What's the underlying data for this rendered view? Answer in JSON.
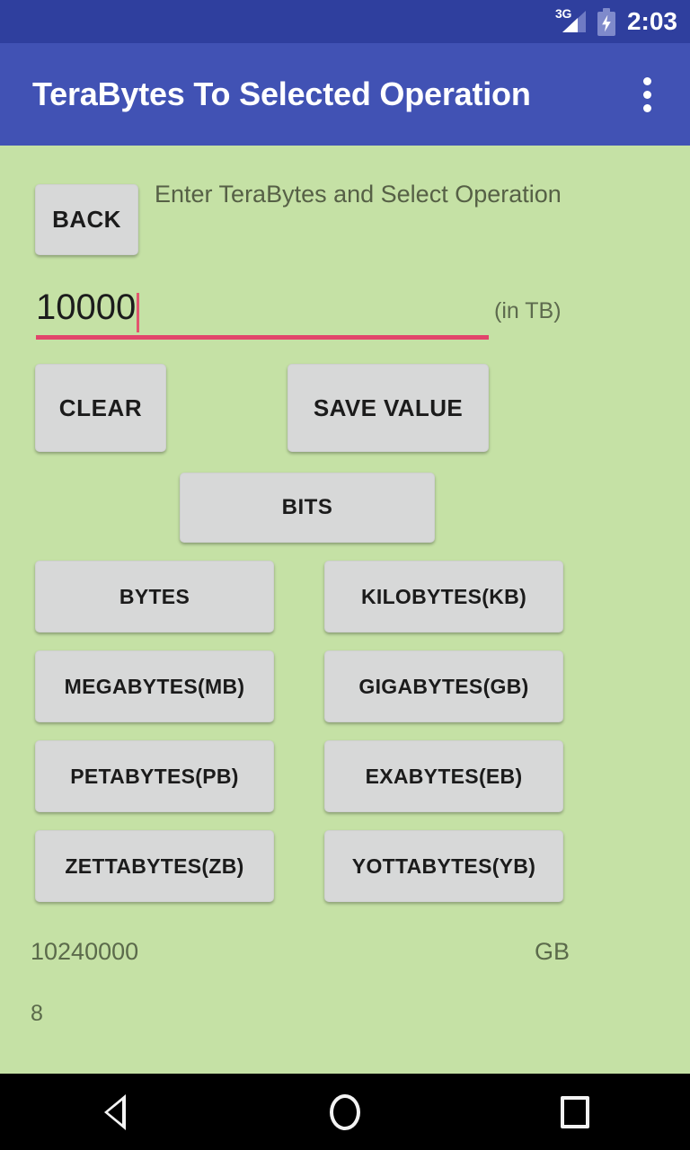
{
  "status_bar": {
    "network_label": "3G",
    "time": "2:03",
    "signal_icon": "signal-3g-icon",
    "battery_icon": "battery-charging-icon"
  },
  "app_bar": {
    "title": "TeraBytes To Selected Operation",
    "overflow_icon": "overflow-menu-icon",
    "background_color": "#4152b4"
  },
  "theme": {
    "background_color": "#c5e1a5",
    "status_bar_color": "#2f3f9e",
    "button_color": "#d7d8d8",
    "accent_underline_color": "#e2456b",
    "text_muted_color": "#5b6a4b"
  },
  "main": {
    "back_label": "BACK",
    "header_hint": "Enter TeraBytes and Select Operation",
    "input": {
      "value": "10000",
      "unit_hint": "(in TB)"
    },
    "clear_label": "CLEAR",
    "save_label": "SAVE VALUE",
    "bits_label": "BITS",
    "unit_buttons": [
      [
        "BYTES",
        "KILOBYTES(KB)"
      ],
      [
        "MEGABYTES(MB)",
        "GIGABYTES(GB)"
      ],
      [
        "PETABYTES(PB)",
        "EXABYTES(EB)"
      ],
      [
        "ZETTABYTES(ZB)",
        "YOTTABYTES(YB)"
      ]
    ],
    "result": {
      "value": "10240000",
      "unit": "GB",
      "extra": "8"
    }
  },
  "nav_bar": {
    "back_icon": "nav-back-triangle-icon",
    "home_icon": "nav-home-circle-icon",
    "recents_icon": "nav-recents-square-icon"
  }
}
